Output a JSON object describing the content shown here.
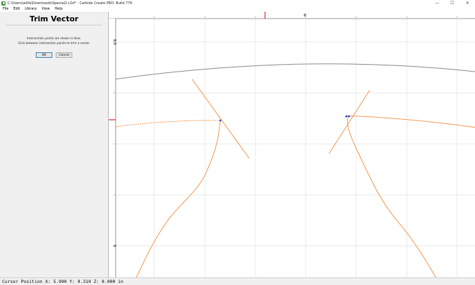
{
  "window": {
    "title": "C:\\Users\\wilfa\\Downloads\\Special2.c2d* - Carbide Create PRO: Build 779",
    "controls": {
      "minimize": "—",
      "maximize": "☐",
      "close": "✕"
    }
  },
  "menu": [
    "File",
    "Edit",
    "Library",
    "View",
    "Help"
  ],
  "panel": {
    "title": "Trim Vector",
    "message_line1": "Intersection points are shown in blue.",
    "message_line2": "Click between intersection points to trim a vector.",
    "ok_label": "OK",
    "cancel_label": "Cancel"
  },
  "rulers": {
    "top_label": "6",
    "left_label_upper": "9.5",
    "left_label_lower": "9"
  },
  "colors": {
    "vector": "#f08a3a",
    "arc": "#888888",
    "cursor_marker": "#e8202a",
    "intersection": "#2b3cc9"
  },
  "status": {
    "cursor_position": "Cursor Position X: 5.900 Y: 9.310 Z: 0.000 in"
  }
}
